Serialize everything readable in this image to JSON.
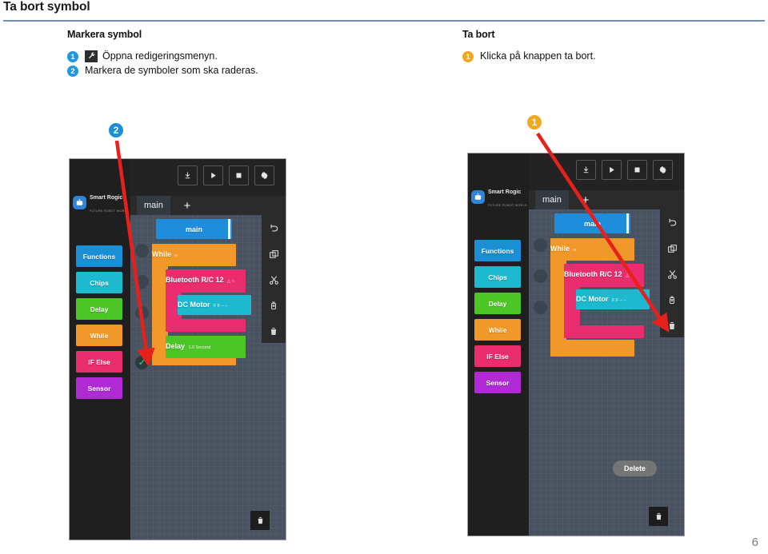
{
  "document": {
    "title": "Ta bort symbol",
    "page_number": "6"
  },
  "left_column": {
    "heading": "Markera symbol",
    "steps": [
      {
        "number": "1",
        "marker_color": "#2196e3",
        "icon": "wrench-icon",
        "text": "Öppna redigeringsmenyn."
      },
      {
        "number": "2",
        "marker_color": "#2196e3",
        "icon": null,
        "text": "Markera de symboler som ska raderas."
      }
    ],
    "callout": {
      "number": "2",
      "color": "#1b8fd6"
    }
  },
  "right_column": {
    "heading": "Ta bort",
    "steps": [
      {
        "number": "1",
        "marker_color": "#f0a81e",
        "icon": null,
        "text": "Klicka på knappen ta bort."
      }
    ],
    "callout": {
      "number": "1",
      "color": "#f0a81e"
    }
  },
  "app": {
    "brand": {
      "name": "Smart Rogic",
      "tagline": "FUTURE ROBOT WORLD",
      "icon": "robot-icon"
    },
    "top_toolbar": [
      {
        "name": "download-icon",
        "glyph": "⬇"
      },
      {
        "name": "play-icon",
        "glyph": "▶"
      },
      {
        "name": "stop-icon",
        "glyph": "■"
      },
      {
        "name": "settings-icon",
        "glyph": "⚙"
      }
    ],
    "tab": {
      "label": "main",
      "add_label": "+"
    },
    "side_tools": [
      {
        "name": "undo-icon",
        "glyph": "↶"
      },
      {
        "name": "duplicate-icon",
        "glyph": "❐"
      },
      {
        "name": "cut-icon",
        "glyph": "✂"
      },
      {
        "name": "paste-icon",
        "glyph": "⎙"
      },
      {
        "name": "delete-icon",
        "glyph": "Ὕ1"
      }
    ],
    "palette": [
      {
        "label": "Functions",
        "color": "#1b8fd6"
      },
      {
        "label": "Chips",
        "color": "#1cb9cf"
      },
      {
        "label": "Delay",
        "color": "#4cc526"
      },
      {
        "label": "While",
        "color": "#f1982a"
      },
      {
        "label": "IF Else",
        "color": "#ea2d6e"
      },
      {
        "label": "Sensor",
        "color": "#b12ad6"
      }
    ]
  },
  "figure_left": {
    "caption_state": "symbols selected",
    "blocks": [
      {
        "label": "main",
        "sub": "",
        "color": "#1e8ddb"
      },
      {
        "label": "While",
        "sub": "∞",
        "color": "#f1982a"
      },
      {
        "label": "Bluetooth R/C 12",
        "sub": "△ ○",
        "color": "#ea2d6e"
      },
      {
        "label": "DC Motor",
        "sub": "F  F   –  –",
        "color": "#1cb9cf"
      },
      {
        "label": "Delay",
        "sub": "1.0 Second",
        "color": "#4cc526"
      }
    ],
    "selection_marks": [
      "unchecked",
      "unchecked",
      "unchecked",
      "checked"
    ]
  },
  "figure_right": {
    "caption_state": "delete pressed",
    "blocks": [
      {
        "label": "main",
        "sub": "",
        "color": "#1e8ddb"
      },
      {
        "label": "While",
        "sub": "∞",
        "color": "#f1982a"
      },
      {
        "label": "Bluetooth R/C 12",
        "sub": "△ ○",
        "color": "#ea2d6e"
      },
      {
        "label": "DC Motor",
        "sub": "F  F   –  –",
        "color": "#1cb9cf"
      }
    ],
    "toast": "Delete",
    "selection_marks": [
      "unchecked",
      "unchecked",
      "unchecked"
    ]
  },
  "colors": {
    "rule": "#6f8fbf",
    "arrow": "#e8201c",
    "canvas": "#495260",
    "app_dark": "#1f1f1f"
  }
}
